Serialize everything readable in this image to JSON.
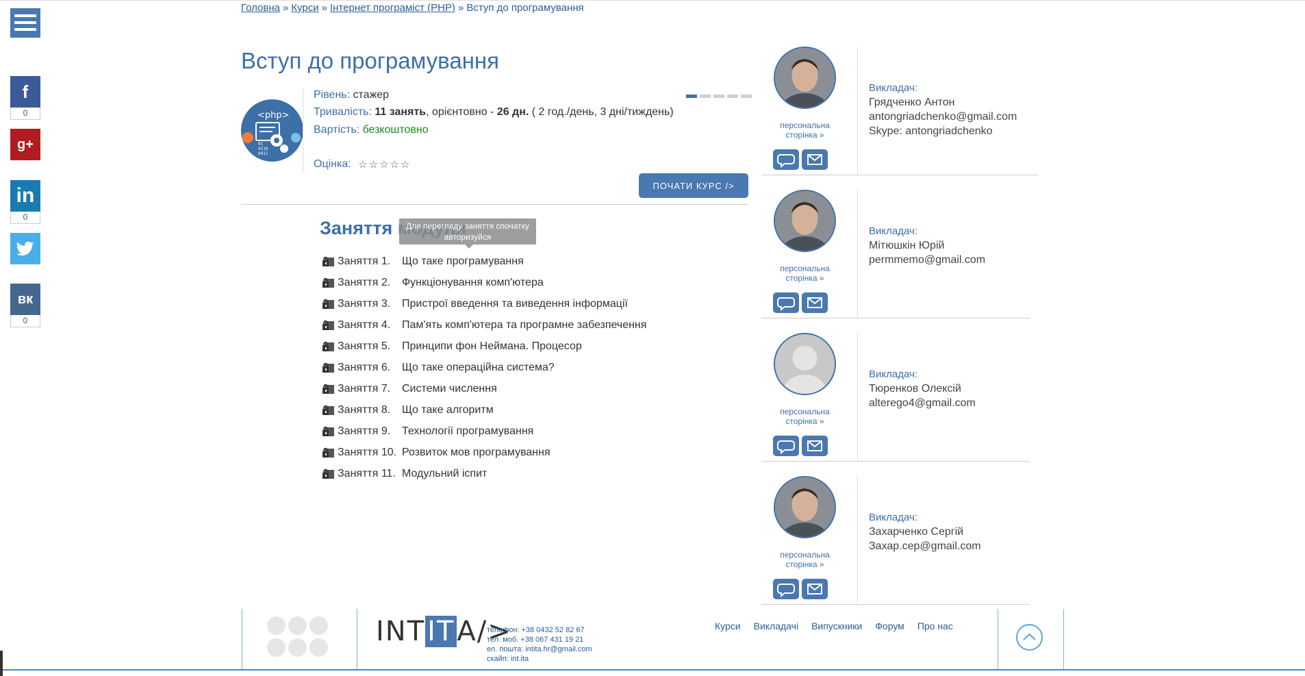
{
  "breadcrumb": {
    "items": [
      "Головна",
      "Курси",
      "Інтернет програміст (PHP)"
    ],
    "separator": "»",
    "current": "Вступ до програмування"
  },
  "social": {
    "facebook_count": "0",
    "linkedin_count": "0",
    "vk_count": "0"
  },
  "course": {
    "title": "Вступ до програмування",
    "logo_text": "<php>",
    "level_label": "Рівень:",
    "level_value": "стажер",
    "duration_label": "Тривалість:",
    "duration_lessons": "11 занять",
    "duration_mid": ", орієнтовно -",
    "duration_days": "26 дн.",
    "duration_detail": "( 2 год./день, 3 дні/тиждень)",
    "price_label": "Вартість:",
    "price_value": "безкоштовно",
    "rating_label": "Оцінка:",
    "rating_value": 0,
    "rating_max": 5,
    "start_button": "ПОЧАТИ КУРС />"
  },
  "modules": {
    "title": "Заняття модуля",
    "tooltip": "Для перегляду заняття спочатку авторизуйся",
    "lessons": [
      {
        "num": "Заняття 1.",
        "title": "Що таке програмування"
      },
      {
        "num": "Заняття 2.",
        "title": "Функціонування комп'ютера"
      },
      {
        "num": "Заняття 3.",
        "title": "Пристрої введення та виведення інформації"
      },
      {
        "num": "Заняття 4.",
        "title": "Пам'ять комп'ютера та програмне забезпечення"
      },
      {
        "num": "Заняття 5.",
        "title": "Принципи фон Неймана. Процесор"
      },
      {
        "num": "Заняття 6.",
        "title": "Що таке операційна система?"
      },
      {
        "num": "Заняття 7.",
        "title": "Системи числення"
      },
      {
        "num": "Заняття 8.",
        "title": "Що таке алгоритм"
      },
      {
        "num": "Заняття 9.",
        "title": "Технології програмування"
      },
      {
        "num": "Заняття 10.",
        "title": "Розвиток мов програмування"
      },
      {
        "num": "Заняття 11.",
        "title": "Модульний іспит"
      }
    ]
  },
  "teachers": [
    {
      "label": "Викладач:",
      "name": "Грядченко Антон",
      "email": "antongriadchenko@gmail.com",
      "skype": "Skype: antongriadchenko",
      "page_link": "персональна сторінка »"
    },
    {
      "label": "Викладач:",
      "name": "Мітюшкін Юрій",
      "email": "permmemo@gmail.com",
      "skype": "",
      "page_link": "персональна сторінка »"
    },
    {
      "label": "Викладач:",
      "name": "Тюренков Олексій",
      "email": "alterego4@gmail.com",
      "skype": "",
      "page_link": "персональна сторінка »"
    },
    {
      "label": "Викладач:",
      "name": "Захарченко Сергій",
      "email": "Захар.сер@gmail.com",
      "skype": "",
      "page_link": "персональна сторінка »"
    }
  ],
  "footer": {
    "logo_left": "INT",
    "logo_it": "IT",
    "logo_right": "A/>",
    "phone": "телефон: +38 0432 52 82 67",
    "mobile": "тел. моб. +38 067 431 19 21",
    "email": "ел. пошта: intita.hr@gmail.com",
    "skype": "скайп: int.ita",
    "nav": [
      "Курси",
      "Викладачі",
      "Випускники",
      "Форум",
      "Про нас"
    ]
  },
  "colors": {
    "brand": "#4a78b0",
    "accent_text": "#3d6fa8",
    "facebook": "#3b5b98",
    "googleplus": "#b01c20",
    "linkedin": "#1a7bb0",
    "twitter": "#4aaee8",
    "vk": "#44678e",
    "free": "#1a8a1a"
  }
}
